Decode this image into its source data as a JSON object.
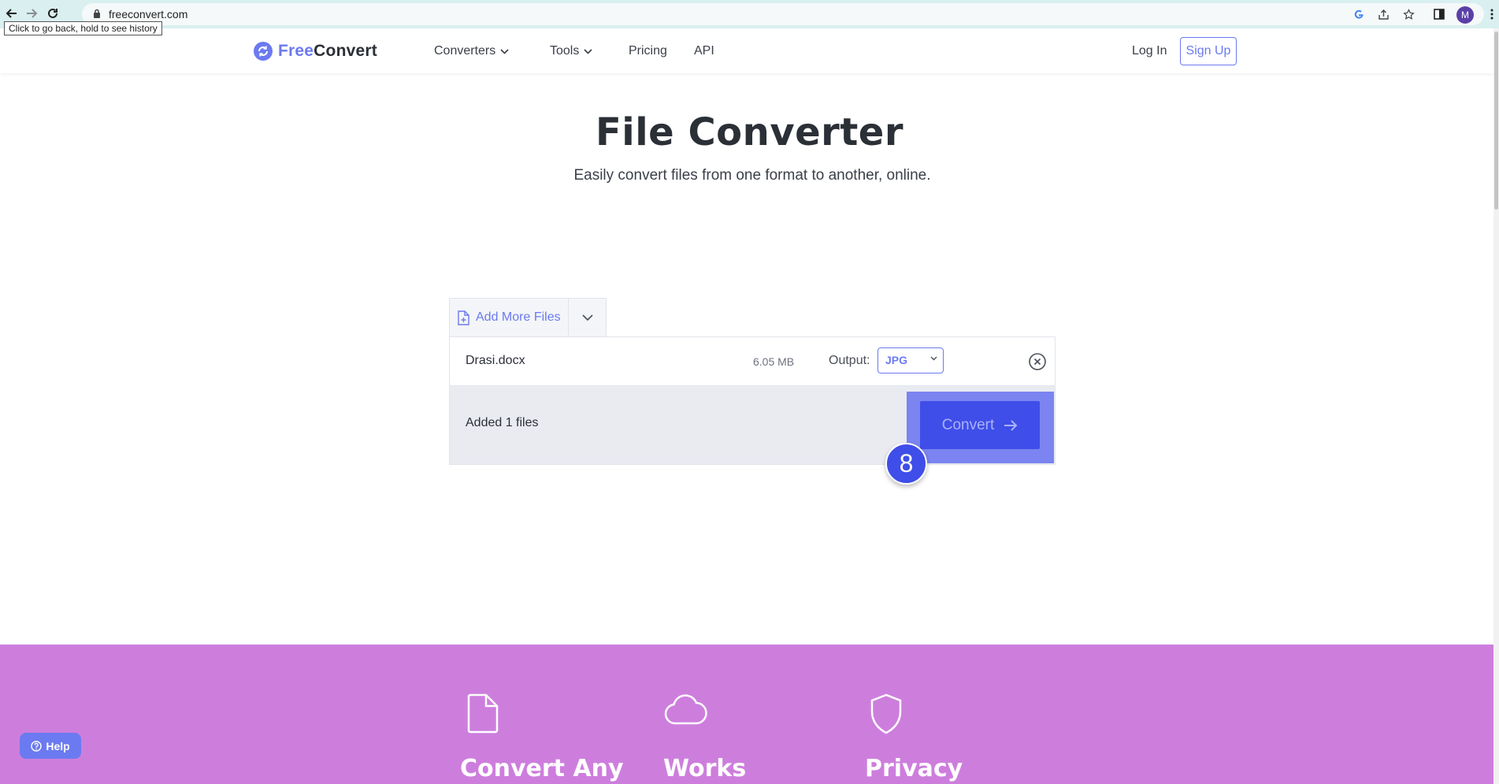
{
  "browser": {
    "url": "freeconvert.com",
    "tooltip": "Click to go back, hold to see history",
    "avatar_letter": "M"
  },
  "header": {
    "logo_free": "Free",
    "logo_convert": "Convert",
    "nav": [
      {
        "label": "Converters",
        "has_dropdown": true
      },
      {
        "label": "Tools",
        "has_dropdown": true
      },
      {
        "label": "Pricing",
        "has_dropdown": false
      },
      {
        "label": "API",
        "has_dropdown": false
      }
    ],
    "login": "Log In",
    "signup": "Sign Up"
  },
  "hero": {
    "title": "File Converter",
    "subtitle": "Easily convert files from one format to another, online."
  },
  "converter": {
    "add_more_label": "Add More Files",
    "file": {
      "name": "Drasi.docx",
      "size": "6.05 MB",
      "output_label": "Output:",
      "output_value": "JPG"
    },
    "added_text": "Added 1 files",
    "convert_label": "Convert",
    "step_number": "8"
  },
  "features": [
    {
      "title": "Convert Any",
      "icon": "document-icon"
    },
    {
      "title": "Works",
      "icon": "cloud-icon"
    },
    {
      "title": "Privacy",
      "icon": "shield-icon"
    }
  ],
  "help_label": "Help",
  "colors": {
    "accent": "#6b7af0",
    "convert_button": "#3f4ee8",
    "band": "#cd7edd",
    "chrome": "#d9eff0"
  }
}
